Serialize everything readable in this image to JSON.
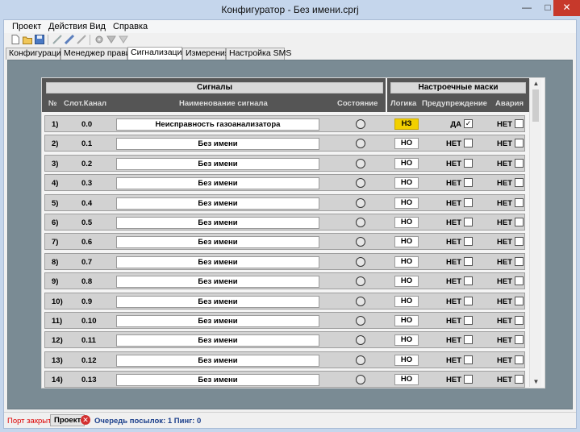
{
  "window": {
    "title": "Конфигуратор - Без имени.cprj",
    "minimize": "—",
    "maximize": "□",
    "close": "✕"
  },
  "menu": [
    "Проект",
    "Действия",
    "Вид",
    "Справка"
  ],
  "toolbar_icons": [
    "new-file-icon",
    "open-folder-icon",
    "save-icon",
    "tool-1-icon",
    "tool-2-icon",
    "tool-3-icon",
    "settings-icon",
    "tool-4-icon",
    "tool-5-icon"
  ],
  "tabs": [
    {
      "label": "Конфигурация",
      "active": false
    },
    {
      "label": "Менеджер правил",
      "active": false
    },
    {
      "label": "Сигнализация",
      "active": true
    },
    {
      "label": "Измерения",
      "active": false
    },
    {
      "label": "Настройка SMS",
      "active": false
    }
  ],
  "table": {
    "group_signals": "Сигналы",
    "group_masks": "Настроечные маски",
    "col_num": "№",
    "col_channel": "Слот.Канал",
    "col_name": "Наименование сигнала",
    "col_state": "Состояние",
    "col_logic": "Логика",
    "col_warning": "Предупреждение",
    "col_alarm": "Авария",
    "rows": [
      {
        "num": "1)",
        "channel": "0.0",
        "name": "Неисправность газоанализатора",
        "logic": "НЗ",
        "logic_highlight": true,
        "warning": "ДА",
        "warning_checked": "✓",
        "alarm": "НЕТ"
      },
      {
        "num": "2)",
        "channel": "0.1",
        "name": "Без имени",
        "logic": "НО",
        "logic_highlight": false,
        "warning": "НЕТ",
        "warning_checked": "",
        "alarm": "НЕТ"
      },
      {
        "num": "3)",
        "channel": "0.2",
        "name": "Без имени",
        "logic": "НО",
        "logic_highlight": false,
        "warning": "НЕТ",
        "warning_checked": "",
        "alarm": "НЕТ"
      },
      {
        "num": "4)",
        "channel": "0.3",
        "name": "Без имени",
        "logic": "НО",
        "logic_highlight": false,
        "warning": "НЕТ",
        "warning_checked": "",
        "alarm": "НЕТ"
      },
      {
        "num": "5)",
        "channel": "0.4",
        "name": "Без имени",
        "logic": "НО",
        "logic_highlight": false,
        "warning": "НЕТ",
        "warning_checked": "",
        "alarm": "НЕТ"
      },
      {
        "num": "6)",
        "channel": "0.5",
        "name": "Без имени",
        "logic": "НО",
        "logic_highlight": false,
        "warning": "НЕТ",
        "warning_checked": "",
        "alarm": "НЕТ"
      },
      {
        "num": "7)",
        "channel": "0.6",
        "name": "Без имени",
        "logic": "НО",
        "logic_highlight": false,
        "warning": "НЕТ",
        "warning_checked": "",
        "alarm": "НЕТ"
      },
      {
        "num": "8)",
        "channel": "0.7",
        "name": "Без имени",
        "logic": "НО",
        "logic_highlight": false,
        "warning": "НЕТ",
        "warning_checked": "",
        "alarm": "НЕТ"
      },
      {
        "num": "9)",
        "channel": "0.8",
        "name": "Без имени",
        "logic": "НО",
        "logic_highlight": false,
        "warning": "НЕТ",
        "warning_checked": "",
        "alarm": "НЕТ"
      },
      {
        "num": "10)",
        "channel": "0.9",
        "name": "Без имени",
        "logic": "НО",
        "logic_highlight": false,
        "warning": "НЕТ",
        "warning_checked": "",
        "alarm": "НЕТ"
      },
      {
        "num": "11)",
        "channel": "0.10",
        "name": "Без имени",
        "logic": "НО",
        "logic_highlight": false,
        "warning": "НЕТ",
        "warning_checked": "",
        "alarm": "НЕТ"
      },
      {
        "num": "12)",
        "channel": "0.11",
        "name": "Без имени",
        "logic": "НО",
        "logic_highlight": false,
        "warning": "НЕТ",
        "warning_checked": "",
        "alarm": "НЕТ"
      },
      {
        "num": "13)",
        "channel": "0.12",
        "name": "Без имени",
        "logic": "НО",
        "logic_highlight": false,
        "warning": "НЕТ",
        "warning_checked": "",
        "alarm": "НЕТ"
      },
      {
        "num": "14)",
        "channel": "0.13",
        "name": "Без имени",
        "logic": "НО",
        "logic_highlight": false,
        "warning": "НЕТ",
        "warning_checked": "",
        "alarm": "НЕТ"
      }
    ]
  },
  "scroll": {
    "up": "▲",
    "down": "▼"
  },
  "status": {
    "port": "Порт закрыт",
    "project": "Проект",
    "error_icon": "✕",
    "queue": "Очередь посылок: 1 Пинг: 0"
  }
}
